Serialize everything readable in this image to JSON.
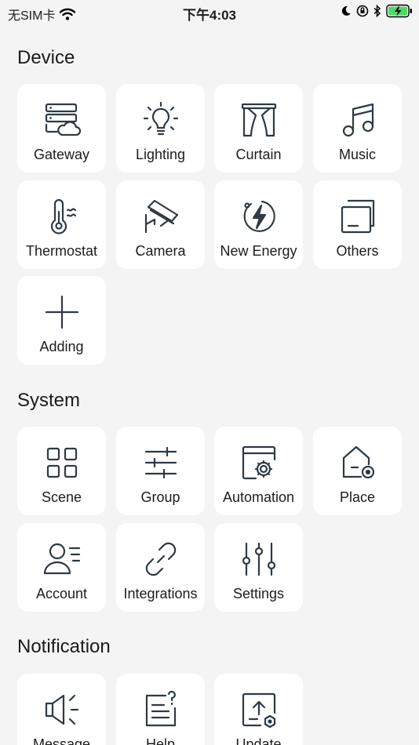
{
  "status_bar": {
    "carrier": "无SIM卡",
    "time": "下午4:03",
    "icons": [
      "wifi-icon",
      "moon-icon",
      "orientation-lock-icon",
      "bluetooth-icon",
      "battery-charging-icon"
    ],
    "battery_color": "#4cd964"
  },
  "sections": {
    "device": {
      "title": "Device",
      "items": [
        {
          "label": "Gateway",
          "icon": "gateway-icon"
        },
        {
          "label": "Lighting",
          "icon": "bulb-icon"
        },
        {
          "label": "Curtain",
          "icon": "curtain-icon"
        },
        {
          "label": "Music",
          "icon": "music-note-icon"
        },
        {
          "label": "Thermostat",
          "icon": "thermometer-icon"
        },
        {
          "label": "Camera",
          "icon": "camera-icon"
        },
        {
          "label": "New Energy",
          "icon": "energy-bolt-icon"
        },
        {
          "label": "Others",
          "icon": "stacked-squares-icon"
        },
        {
          "label": "Adding",
          "icon": "plus-icon"
        }
      ]
    },
    "system": {
      "title": "System",
      "items": [
        {
          "label": "Scene",
          "icon": "grid-icon"
        },
        {
          "label": "Group",
          "icon": "sliders-icon"
        },
        {
          "label": "Automation",
          "icon": "automation-gear-icon"
        },
        {
          "label": "Place",
          "icon": "house-settings-icon"
        },
        {
          "label": "Account",
          "icon": "user-list-icon"
        },
        {
          "label": "Integrations",
          "icon": "link-icon"
        },
        {
          "label": "Settings",
          "icon": "equalizer-icon"
        }
      ]
    },
    "notification": {
      "title": "Notification",
      "items": [
        {
          "label": "Message",
          "icon": "speaker-icon"
        },
        {
          "label": "Help",
          "icon": "help-document-icon"
        },
        {
          "label": "Update",
          "icon": "update-upload-icon"
        }
      ]
    }
  }
}
